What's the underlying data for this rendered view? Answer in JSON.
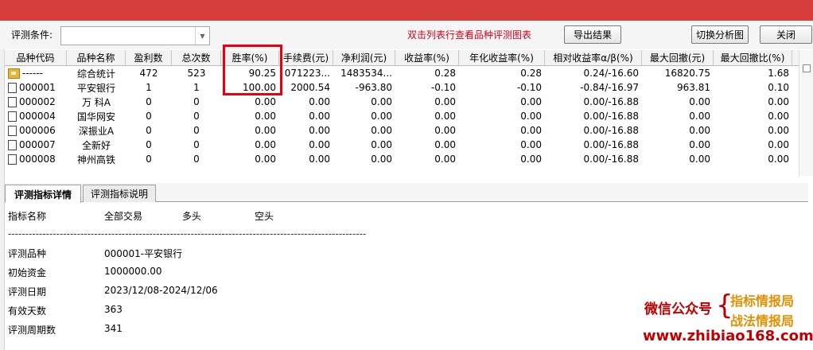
{
  "toolbar": {
    "condition_label": "评测条件:",
    "condition_value": "",
    "hint": "双击列表行查看品种评测图表",
    "export_label": "导出结果",
    "switch_label": "切换分析图",
    "close_label": "关闭"
  },
  "grid": {
    "headers": [
      "品种代码",
      "品种名称",
      "盈利数",
      "总次数",
      "胜率(%)",
      "手续费(元)",
      "净利润(元)",
      "收益率(%)",
      "年化收益率(%)",
      "相对收益率α/β(%)",
      "最大回撤(元)",
      "最大回撤比(%)"
    ],
    "rows": [
      {
        "icon": "folder-icon",
        "code": "------",
        "name": "综合统计",
        "win": "472",
        "total": "523",
        "rate": "90.25",
        "fee": "071223...",
        "net": "1483534...",
        "ret": "0.28",
        "ann": "0.28",
        "rel": "0.24/-16.60",
        "dd": "16820.75",
        "ddr": "1.68"
      },
      {
        "icon": "document-icon",
        "code": "000001",
        "name": "平安银行",
        "win": "1",
        "total": "1",
        "rate": "100.00",
        "fee": "2000.54",
        "net": "-963.80",
        "ret": "-0.10",
        "ann": "-0.10",
        "rel": "-0.84/-16.97",
        "dd": "963.81",
        "ddr": "0.10"
      },
      {
        "icon": "document-icon",
        "code": "000002",
        "name": "万 科A",
        "win": "0",
        "total": "0",
        "rate": "0.00",
        "fee": "0.00",
        "net": "0.00",
        "ret": "0.00",
        "ann": "0.00",
        "rel": "0.00/-16.88",
        "dd": "0.00",
        "ddr": "0.00"
      },
      {
        "icon": "document-icon",
        "code": "000004",
        "name": "国华网安",
        "win": "0",
        "total": "0",
        "rate": "0.00",
        "fee": "0.00",
        "net": "0.00",
        "ret": "0.00",
        "ann": "0.00",
        "rel": "0.00/-16.88",
        "dd": "0.00",
        "ddr": "0.00"
      },
      {
        "icon": "document-icon",
        "code": "000006",
        "name": "深振业A",
        "win": "0",
        "total": "0",
        "rate": "0.00",
        "fee": "0.00",
        "net": "0.00",
        "ret": "0.00",
        "ann": "0.00",
        "rel": "0.00/-16.88",
        "dd": "0.00",
        "ddr": "0.00"
      },
      {
        "icon": "document-icon",
        "code": "000007",
        "name": "全新好",
        "win": "0",
        "total": "0",
        "rate": "0.00",
        "fee": "0.00",
        "net": "0.00",
        "ret": "0.00",
        "ann": "0.00",
        "rel": "0.00/-16.88",
        "dd": "0.00",
        "ddr": "0.00"
      },
      {
        "icon": "document-icon",
        "code": "000008",
        "name": "神州高铁",
        "win": "0",
        "total": "0",
        "rate": "0.00",
        "fee": "0.00",
        "net": "0.00",
        "ret": "0.00",
        "ann": "0.00",
        "rel": "0.00/-16.88",
        "dd": "0.00",
        "ddr": "0.00"
      }
    ]
  },
  "tabs": {
    "detail": "评测指标详情",
    "desc": "评测指标说明"
  },
  "detail": {
    "head_name": "指标名称",
    "head_all": "全部交易",
    "head_long": "多头",
    "head_short": "空头",
    "separator": "--------------------------------------------------------------------------------------------------------",
    "items": [
      {
        "k": "评测品种",
        "v": "000001-平安银行"
      },
      {
        "k": "初始资金",
        "v": "1000000.00"
      },
      {
        "k": "评测日期",
        "v": "2023/12/08-2024/12/06"
      },
      {
        "k": "有效天数",
        "v": "363"
      },
      {
        "k": "评测周期数",
        "v": " 341"
      }
    ]
  },
  "watermark": {
    "wechat": "微信公众号",
    "brace": "{",
    "name1": "指标情报局",
    "name2": "战法情报局",
    "url": "www.zhibiao168.com"
  },
  "colors": {
    "titlebar": "#d63d3d",
    "hint": "#d0021b",
    "highlight": "#e60012"
  }
}
